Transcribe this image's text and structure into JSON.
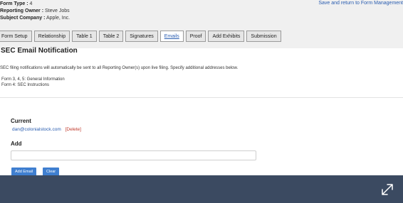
{
  "header": {
    "form_type_label": "Form Type :",
    "form_type_value": "4",
    "owner_label": "Reporting Owner :",
    "owner_value": "Steve Jobs",
    "company_label": "Subject Company :",
    "company_value": "Apple, Inc.",
    "save_link": "Save and return to Form Management"
  },
  "tabs": [
    {
      "label": "Form Setup"
    },
    {
      "label": "Relationship"
    },
    {
      "label": "Table 1"
    },
    {
      "label": "Table 2"
    },
    {
      "label": "Signatures"
    },
    {
      "label": "Emails"
    },
    {
      "label": "Proof"
    },
    {
      "label": "Add Exhibits"
    },
    {
      "label": "Submission"
    }
  ],
  "active_tab": "Emails",
  "section_title": "SEC Email Notification",
  "notice": "SEC filing notifications will automatically be sent to all Reporting Owner(s) upon live filing. Specify additional addresses below.",
  "form_lines": [
    "Form 3, 4, 5: General Information",
    "Form 4: SEC Instructions"
  ],
  "current": {
    "label": "Current",
    "email": "dan@colonialstock.com",
    "delete_label": "[Delete]"
  },
  "add": {
    "label": "Add",
    "value": ""
  },
  "buttons": {
    "add_email": "Add Email",
    "clear": "Clear"
  },
  "colors": {
    "link": "#2a5db0",
    "delete": "#c0392b",
    "button": "#3f7fd0",
    "overlay": "#3b4a61",
    "input_icon": "#e0413a"
  }
}
